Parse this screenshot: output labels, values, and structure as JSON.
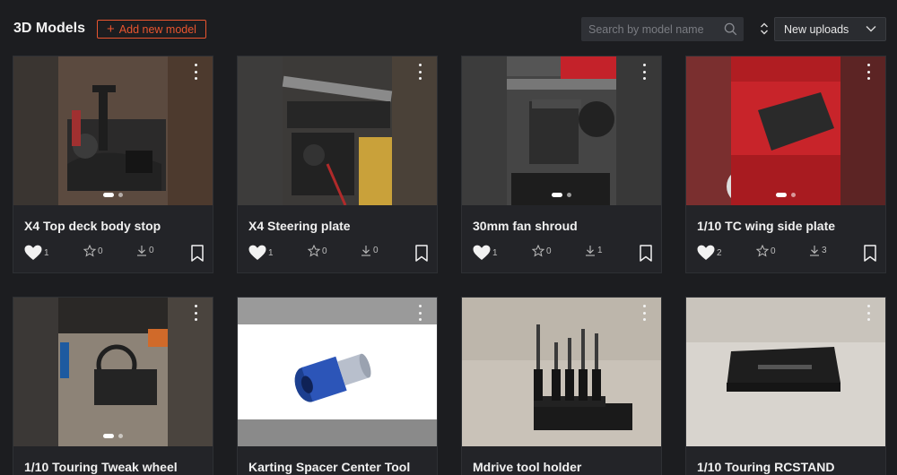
{
  "header": {
    "title": "3D Models",
    "add_button": "Add new model",
    "search_placeholder": "Search by model name",
    "sort_value": "New uploads"
  },
  "colors": {
    "accent": "#e8552f",
    "background": "#1c1d20",
    "card": "#232428"
  },
  "models": [
    {
      "name": "X4 Top deck body stop",
      "likes": "1",
      "stars": "0",
      "downloads": "0"
    },
    {
      "name": "X4 Steering plate",
      "likes": "1",
      "stars": "0",
      "downloads": "0"
    },
    {
      "name": "30mm fan shroud",
      "likes": "1",
      "stars": "0",
      "downloads": "1"
    },
    {
      "name": "1/10 TC wing side plate",
      "likes": "2",
      "stars": "0",
      "downloads": "3"
    },
    {
      "name": "1/10 Touring Tweak wheel"
    },
    {
      "name": "Karting Spacer Center Tool"
    },
    {
      "name": "Mdrive tool holder"
    },
    {
      "name": "1/10 Touring RCSTAND"
    }
  ],
  "icons": {
    "like": "heart-icon",
    "star": "star-icon",
    "download": "download-icon",
    "bookmark": "bookmark-icon",
    "menu": "more-vertical-icon",
    "search": "search-icon",
    "sort": "sort-icon",
    "dropdown": "chevron-down-icon"
  }
}
